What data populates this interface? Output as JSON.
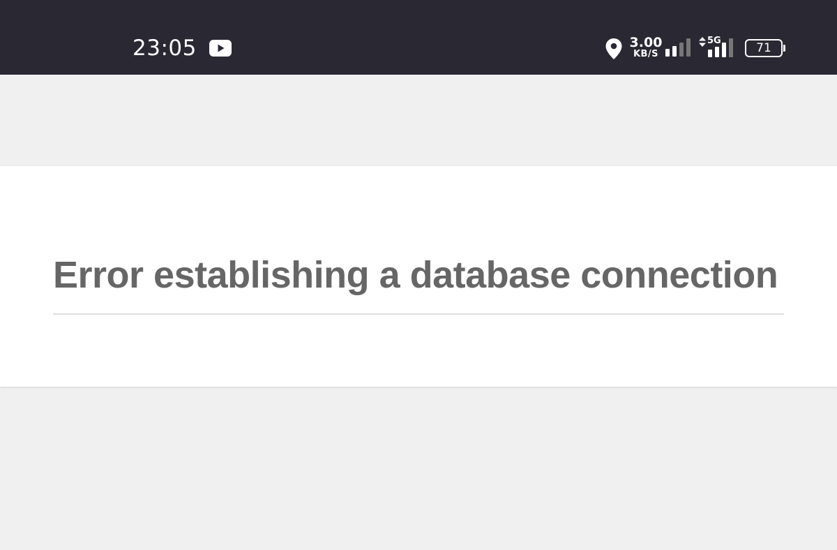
{
  "status_bar": {
    "time": "23:05",
    "notification_icon": "youtube-icon",
    "location_icon": "location-pin-icon",
    "network_speed": {
      "value": "3.00",
      "unit": "KB/S"
    },
    "network_type": "5G",
    "battery_level": "71",
    "colors": {
      "background": "#2a2832",
      "foreground": "#ffffff"
    }
  },
  "error_page": {
    "title": "Error establishing a database connection",
    "colors": {
      "title": "#666666",
      "card_background": "#ffffff",
      "page_background": "#f0f0f0"
    }
  }
}
